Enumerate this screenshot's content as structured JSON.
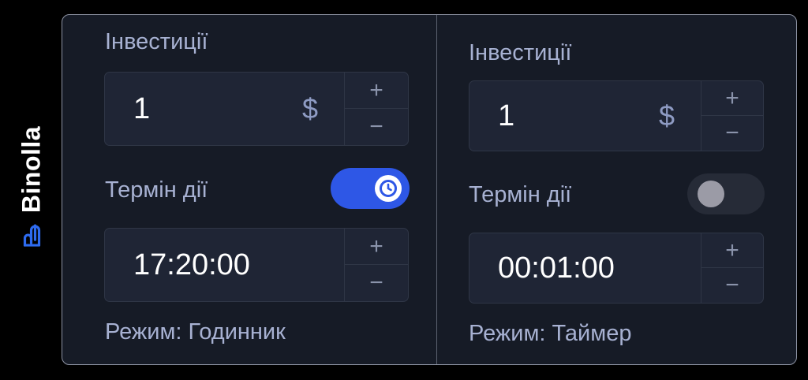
{
  "brand": {
    "name": "Binolla",
    "color": "#2e6bf0"
  },
  "left_panel": {
    "investment_label": "Інвестиції",
    "investment_value": "1",
    "currency": "$",
    "plus": "+",
    "minus": "−",
    "term_label": "Термін дії",
    "toggle_state": "on",
    "toggle_icon": "clock-icon",
    "time_value": "17:20:00",
    "mode_text": "Режим: Годинник"
  },
  "right_panel": {
    "investment_label": "Інвестиції",
    "investment_value": "1",
    "currency": "$",
    "plus": "+",
    "minus": "−",
    "term_label": "Термін дії",
    "toggle_state": "off",
    "time_value": "00:01:00",
    "mode_text": "Режим: Таймер"
  },
  "colors": {
    "accent": "#2e57e6",
    "label": "#a7b1d2",
    "field_bg": "#1f2535",
    "card_bg": "#161b26"
  }
}
